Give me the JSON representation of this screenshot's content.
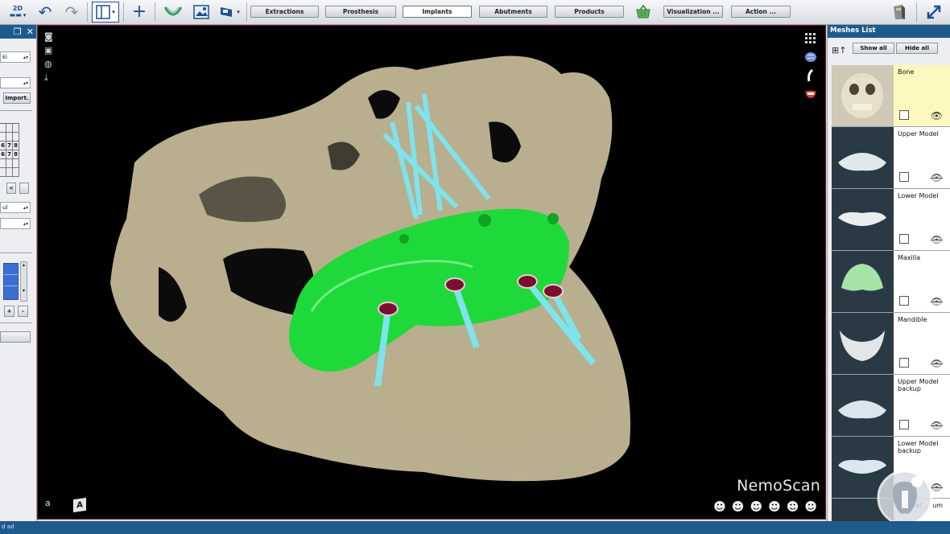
{
  "toolbar": {
    "view_mode": "2D",
    "icons": {
      "undo": "undo-icon",
      "redo": "redo-icon",
      "layout": "layout-icon",
      "add": "plus-icon",
      "arch": "dental-arch-icon",
      "image": "image-icon",
      "scanner": "scanner-icon",
      "basket": "basket-icon",
      "device": "device-icon",
      "fullscreen": "expand-icon"
    },
    "buttons": [
      {
        "id": "extractions",
        "label": "Extractions"
      },
      {
        "id": "prosthesis",
        "label": "Prosthesis"
      },
      {
        "id": "implants",
        "label": "Implants"
      },
      {
        "id": "abutments",
        "label": "Abutments"
      },
      {
        "id": "products",
        "label": "Products"
      },
      {
        "id": "visualization",
        "label": "Visualization ..."
      },
      {
        "id": "action",
        "label": "Action ..."
      }
    ],
    "active_button": "implants"
  },
  "left_panel": {
    "field_1_value": "ki",
    "field_2_value": "",
    "import_label": "Import.",
    "tooth_grid": [
      [
        "",
        "",
        ""
      ],
      [
        "",
        "",
        ""
      ],
      [
        "6",
        "7",
        "8"
      ],
      [
        "6",
        "7",
        "8"
      ],
      [
        "",
        "",
        ""
      ],
      [
        "",
        "",
        ""
      ]
    ],
    "field_3_value": "ul",
    "add_label": "+",
    "remove_label": "-",
    "nav_left": "<"
  },
  "viewport": {
    "brand": "NemoScan",
    "view_label": "a",
    "cube_label": "A",
    "left_tools": [
      "camera-icon",
      "image-icon",
      "globe-icon",
      "download-icon"
    ],
    "right_tools": [
      "grid-icon",
      "brain-icon",
      "nerve-icon",
      "teeth-icon"
    ],
    "head_views": [
      "head-left-icon",
      "head-front-icon",
      "head-right-icon",
      "head-top-icon",
      "head-bottom-icon",
      "head-back-icon"
    ],
    "colors": {
      "bone": "#c9bd9a",
      "guide": "#1fd93a",
      "implant": "#7fe3ec",
      "sleeve": "#7a1030"
    }
  },
  "meshes": {
    "title": "Meshes List",
    "show_all": "Show all",
    "hide_all": "Hide all",
    "items": [
      {
        "label": "Bone",
        "selected": true,
        "visible": true
      },
      {
        "label": "Upper Model",
        "selected": false,
        "visible": false
      },
      {
        "label": "Lower Model",
        "selected": false,
        "visible": false
      },
      {
        "label": "Maxilla",
        "selected": false,
        "visible": false
      },
      {
        "label": "Mandible",
        "selected": false,
        "visible": false
      },
      {
        "label": "Upper Model backup",
        "selected": false,
        "visible": false
      },
      {
        "label": "Lower Model backup",
        "selected": false,
        "visible": false
      },
      {
        "label": "Bracket ... um",
        "selected": false,
        "visible": false
      }
    ]
  },
  "status": {
    "text": "d ad"
  }
}
